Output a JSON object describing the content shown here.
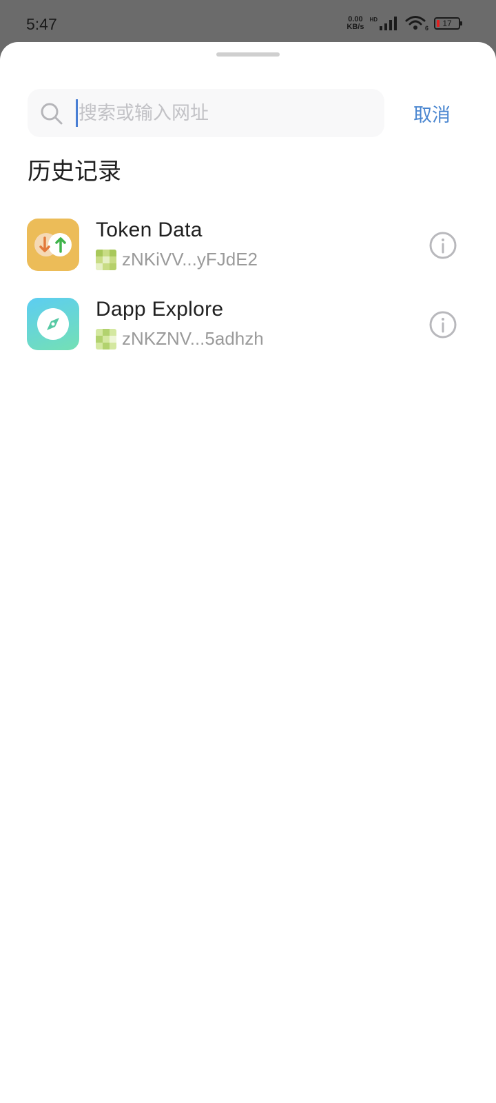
{
  "status_bar": {
    "time": "5:47",
    "net_speed_value": "0.00",
    "net_speed_unit": "KB/s",
    "hd_label": "HD",
    "wifi_badge": "6",
    "battery_level": "17",
    "battery_color": "#e02020"
  },
  "search": {
    "placeholder": "搜索或输入网址",
    "value": "",
    "cancel_label": "取消",
    "accent_color": "#4a86d0",
    "icon": "search-icon"
  },
  "history": {
    "title": "历史记录",
    "items": [
      {
        "name": "Token Data",
        "address": "zNKiVV...yFJdE2",
        "icon": "token-transfer-icon",
        "icon_color": "#ecbc58",
        "action_icon": "info-icon"
      },
      {
        "name": "Dapp Explore",
        "address": "zNKZNV...5adhzh",
        "icon": "compass-icon",
        "icon_color": "#5ccdf2",
        "action_icon": "info-icon"
      }
    ]
  }
}
